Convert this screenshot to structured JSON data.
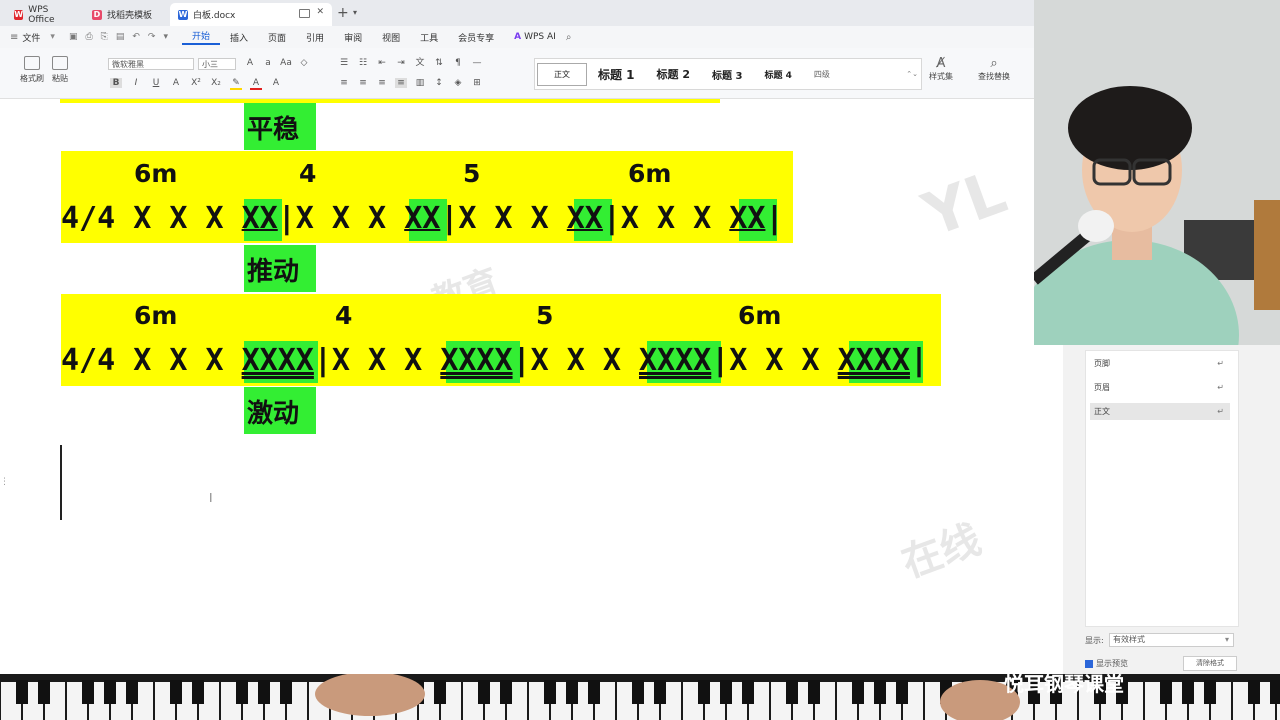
{
  "tabs": [
    {
      "label": "WPS Office",
      "icon": "wps-logo-icon"
    },
    {
      "label": "找稻壳模板",
      "icon": "docer-icon"
    },
    {
      "label": "白板.docx",
      "icon": "word-doc-icon"
    }
  ],
  "menu": {
    "file": "文件",
    "items": [
      "开始",
      "插入",
      "页面",
      "引用",
      "审阅",
      "视图",
      "工具",
      "会员专享"
    ],
    "active": "开始",
    "ai": "WPS AI"
  },
  "ribbon": {
    "format_painter": "格式刷",
    "paste": "粘贴",
    "font_name": "微软雅黑",
    "font_size": "小三",
    "styles_label": "样式集",
    "find_replace": "查找替换",
    "style_items": [
      "正文",
      "标题 1",
      "标题 2",
      "标题 3",
      "标题 4",
      "四级"
    ]
  },
  "document": {
    "block0": {
      "label": "平稳"
    },
    "block1": {
      "chords": [
        "6m",
        "4",
        "5",
        "6m"
      ],
      "prefix": "4/4 X X X ",
      "hit": "XX",
      "mid": "|X X X ",
      "end": "|",
      "label": "推动"
    },
    "block2": {
      "chords": [
        "6m",
        "4",
        "5",
        "6m"
      ],
      "prefix": "4/4 X X X ",
      "hit": "XXXX",
      "mid": "|X X X ",
      "end": "|",
      "label": "激动"
    }
  },
  "side_pane": {
    "items": [
      "页脚",
      "页眉",
      "正文"
    ],
    "selected": "正文",
    "show_label": "显示:",
    "show_value": "有效样式",
    "preview_label": "显示预览",
    "clear_button": "清除格式"
  },
  "branding": "悦耳钢琴课堂",
  "watermark": [
    "YL",
    "教育",
    "在线"
  ],
  "colors": {
    "highlight_yellow": "#ffff00",
    "highlight_green": "#33ee33",
    "accent_blue": "#1a5fd6"
  }
}
